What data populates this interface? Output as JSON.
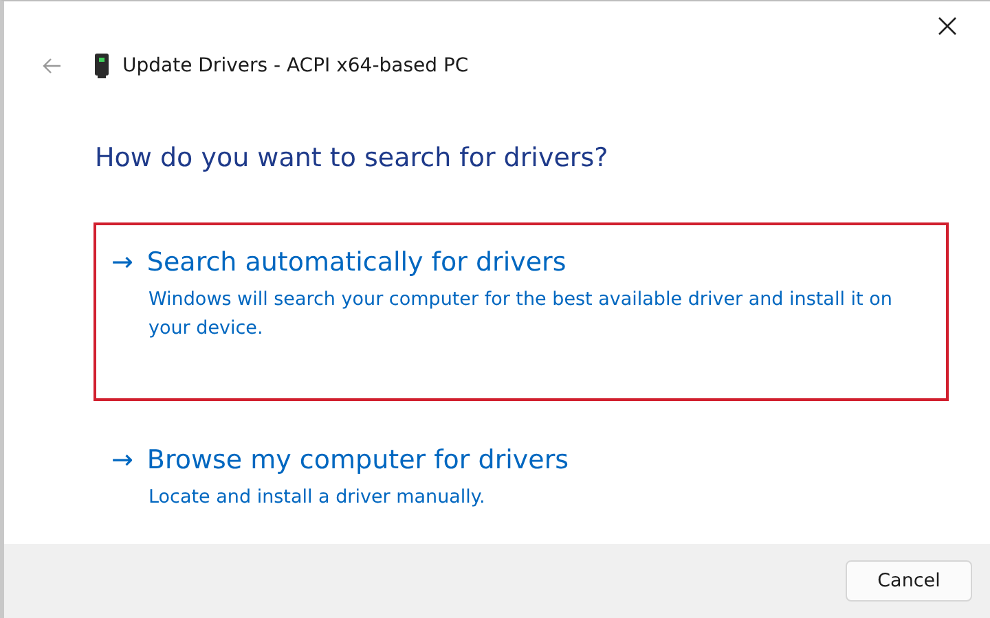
{
  "window": {
    "title": "Update Drivers - ACPI x64-based PC"
  },
  "heading": "How do you want to search for drivers?",
  "options": [
    {
      "arrow": "→",
      "title": "Search automatically for drivers",
      "description": "Windows will search your computer for the best available driver and install it on your device.",
      "highlighted": true
    },
    {
      "arrow": "→",
      "title": "Browse my computer for drivers",
      "description": "Locate and install a driver manually.",
      "highlighted": false
    }
  ],
  "buttons": [
    "Cancel"
  ]
}
